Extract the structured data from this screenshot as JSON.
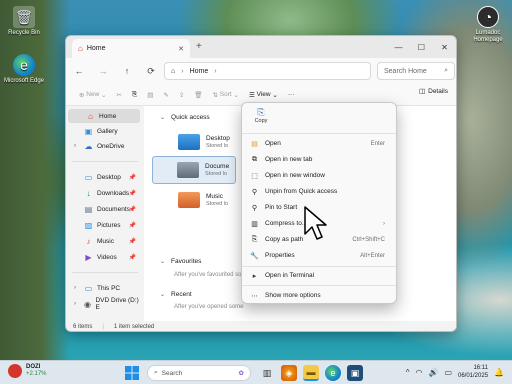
{
  "desktop": {
    "recycle_bin": "Recycle Bin",
    "edge": "Microsoft Edge",
    "right_icon": "Lumadoc Homepage"
  },
  "window": {
    "tab_title": "Home",
    "controls": {
      "minimize": "—",
      "maximize": "☐",
      "close": "✕"
    }
  },
  "navbar": {
    "back": "←",
    "forward": "→",
    "up": "↑",
    "refresh": "⟳",
    "address_root_icon": "⌂",
    "address": "Home",
    "search_placeholder": "Search Home"
  },
  "commandbar": {
    "new_label": "New",
    "sort_label": "Sort",
    "view_label": "View",
    "more_label": "···",
    "details_label": "Details"
  },
  "sidebar": {
    "items": [
      {
        "label": "Home",
        "icon": "home-icon",
        "glyph": "⌂",
        "color": "#c7402b"
      },
      {
        "label": "Gallery",
        "icon": "gallery-icon",
        "glyph": "▣",
        "color": "#2f8fd8"
      },
      {
        "label": "OneDrive",
        "icon": "cloud-icon",
        "glyph": "☁",
        "color": "#2f6fbf"
      },
      {
        "label": "Desktop",
        "icon": "desktop-icon",
        "glyph": "▭",
        "color": "#2f8fd8"
      },
      {
        "label": "Downloads",
        "icon": "download-icon",
        "glyph": "↓",
        "color": "#1e8a3b"
      },
      {
        "label": "Documents",
        "icon": "document-icon",
        "glyph": "▤",
        "color": "#5a6b7c"
      },
      {
        "label": "Pictures",
        "icon": "pictures-icon",
        "glyph": "▨",
        "color": "#2f8fd8"
      },
      {
        "label": "Music",
        "icon": "music-icon",
        "glyph": "♪",
        "color": "#d04a3a"
      },
      {
        "label": "Videos",
        "icon": "video-icon",
        "glyph": "▶",
        "color": "#7a4bd0"
      },
      {
        "label": "This PC",
        "icon": "pc-icon",
        "glyph": "▭",
        "color": "#2f8fd8"
      },
      {
        "label": "DVD Drive (D:) E",
        "icon": "dvd-icon",
        "glyph": "◉",
        "color": "#555555"
      }
    ]
  },
  "content": {
    "quick_access": "Quick access",
    "folders": [
      {
        "name": "Desktop",
        "sub": "Stored lo",
        "color": "#2f8fd8"
      },
      {
        "name": "Docume",
        "sub": "Stored lo",
        "color": "#6d7a86"
      },
      {
        "name": "Music",
        "sub": "Stored lo",
        "color": "#e07a3f"
      }
    ],
    "favourites": "Favourites",
    "favourites_hint": "After you've favourited som",
    "recent": "Recent",
    "recent_hint": "After you've opened some"
  },
  "status": {
    "count": "6 items",
    "selected": "1 item selected"
  },
  "context_menu": {
    "copy_label": "Copy",
    "items": [
      {
        "label": "Open",
        "shortcut": "Enter",
        "icon": "open-icon",
        "glyph": "▤"
      },
      {
        "label": "Open in new tab",
        "shortcut": "",
        "icon": "new-tab-icon",
        "glyph": "⧉"
      },
      {
        "label": "Open in new window",
        "shortcut": "",
        "icon": "new-window-icon",
        "glyph": "⬚"
      },
      {
        "label": "Unpin from Quick access",
        "shortcut": "",
        "icon": "unpin-icon",
        "glyph": "⚲"
      },
      {
        "label": "Pin to Start",
        "shortcut": "",
        "icon": "pin-icon",
        "glyph": "⚲"
      },
      {
        "label": "Compress to...",
        "shortcut": "›",
        "icon": "zip-icon",
        "glyph": "▥"
      },
      {
        "label": "Copy as path",
        "shortcut": "Ctrl+Shift+C",
        "icon": "copy-path-icon",
        "glyph": "⎘"
      },
      {
        "label": "Properties",
        "shortcut": "Alt+Enter",
        "icon": "properties-icon",
        "glyph": "🔧"
      },
      {
        "label": "Open in Terminal",
        "shortcut": "",
        "icon": "terminal-icon",
        "glyph": "▸"
      },
      {
        "label": "Show more options",
        "shortcut": "",
        "icon": "more-options-icon",
        "glyph": "⋯"
      }
    ]
  },
  "taskbar": {
    "weather_name": "DOZI",
    "weather_change": "+2.17%",
    "search_placeholder": "Search",
    "time": "16:11",
    "date": "06/01/2025"
  }
}
